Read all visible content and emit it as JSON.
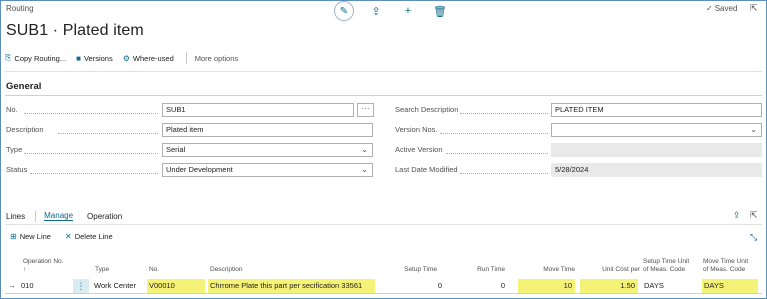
{
  "window": {
    "breadcrumb": "Routing",
    "title": "SUB1 · Plated item",
    "saved_label": "Saved"
  },
  "icons": {
    "edit": "pencil-icon",
    "share": "share-icon",
    "new": "plus-icon",
    "delete": "trash-icon",
    "saved": "checkmark-icon",
    "popout": "open-in-new-window-icon"
  },
  "actions": {
    "copy_routing": "Copy Routing...",
    "versions": "Versions",
    "where_used": "Where-used",
    "more_options": "More options"
  },
  "general": {
    "title": "General",
    "no_label": "No.",
    "no_value": "SUB1",
    "description_label": "Description",
    "description_value": "Plated item",
    "type_label": "Type",
    "type_value": "Serial",
    "status_label": "Status",
    "status_value": "Under Development",
    "search_description_label": "Search Description",
    "search_description_value": "PLATED ITEM",
    "version_nos_label": "Version Nos.",
    "version_nos_value": "",
    "active_version_label": "Active Version",
    "active_version_value": "",
    "last_date_modified_label": "Last Date Modified",
    "last_date_modified_value": "5/28/2024"
  },
  "lines": {
    "title": "Lines",
    "tabs": [
      "Manage",
      "Operation"
    ],
    "new_line": "New Line",
    "delete_line": "Delete Line",
    "columns": {
      "operation_no": "Operation No.",
      "sort_indicator": "↑",
      "type": "Type",
      "no": "No.",
      "description": "Description",
      "setup_time": "Setup Time",
      "run_time": "Run Time",
      "move_time": "Move Time",
      "unit_cost_per": "Unit Cost per",
      "setup_time_unit_line1": "Setup Time Unit",
      "setup_time_unit_line2": "of Meas. Code",
      "move_time_unit_line1": "Move Time Unit",
      "move_time_unit_line2": "of Meas. Code"
    },
    "rows": [
      {
        "operation_no": "010",
        "type": "Work Center",
        "no": "V00010",
        "description": "Chrrome Plate this part per secification 33561",
        "setup_time": "0",
        "run_time": "0",
        "move_time": "10",
        "unit_cost_per": "1.50",
        "setup_time_unit": "DAYS",
        "move_time_unit": "DAYS"
      }
    ]
  },
  "colors": {
    "accent": "#0e6a8a",
    "highlight": "#f4f277",
    "frame": "#5b8fb9"
  }
}
